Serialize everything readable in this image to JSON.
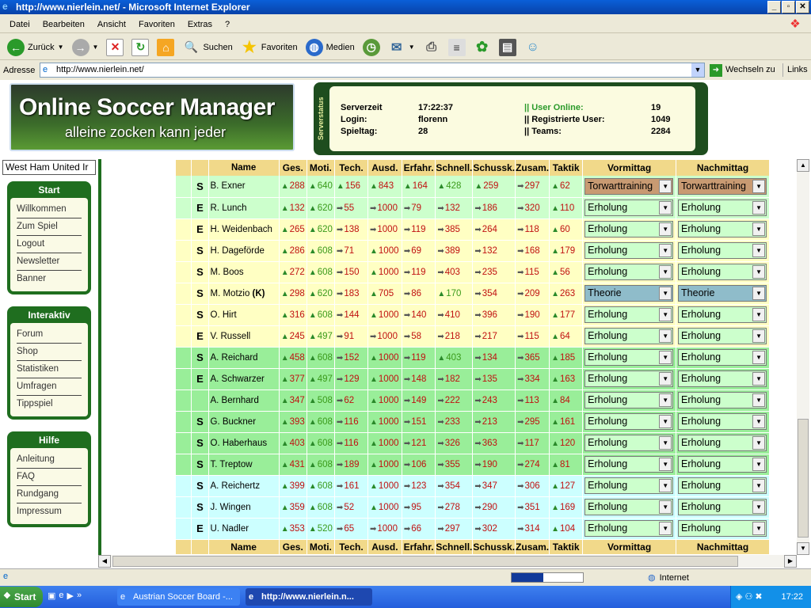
{
  "window": {
    "title": "http://www.nierlein.net/ - Microsoft Internet Explorer"
  },
  "menu": [
    "Datei",
    "Bearbeiten",
    "Ansicht",
    "Favoriten",
    "Extras",
    "?"
  ],
  "toolbar": {
    "back": "Zurück",
    "search": "Suchen",
    "favorites": "Favoriten",
    "media": "Medien"
  },
  "address": {
    "label": "Adresse",
    "url": "http://www.nierlein.net/",
    "go": "Wechseln zu",
    "links": "Links"
  },
  "banner": {
    "title": "Online Soccer Manager",
    "subtitle": "alleine zocken kann jeder"
  },
  "server": {
    "side_label": "Serverstatus",
    "servertime_label": "Serverzeit",
    "servertime": "17:22:37",
    "login_label": "Login:",
    "login": "florenn",
    "matchday_label": "Spieltag:",
    "matchday": "28",
    "online_label": "|| User Online:",
    "online": "19",
    "registered_label": "|| Registrierte User:",
    "registered": "1049",
    "teams_label": "|| Teams:",
    "teams": "2284"
  },
  "sidebar": {
    "team": "West Ham United Ir",
    "boxes": [
      {
        "title": "Start",
        "items": [
          "Willkommen",
          "Zum Spiel",
          "Logout",
          "Newsletter",
          "Banner"
        ]
      },
      {
        "title": "Interaktiv",
        "items": [
          "Forum",
          "Shop",
          "Statistiken",
          "Umfragen",
          "Tippspiel"
        ]
      },
      {
        "title": "Hilfe",
        "items": [
          "Anleitung",
          "FAQ",
          "Rundgang",
          "Impressum"
        ]
      }
    ]
  },
  "table": {
    "headers": [
      "Name",
      "Ges.",
      "Moti.",
      "Tech.",
      "Ausd.",
      "Erfahr.",
      "Schnell.",
      "Schussk.",
      "Zusam.",
      "Taktik",
      "Vormittag",
      "Nachmittag"
    ],
    "rows": [
      {
        "s": "S",
        "name": "B. Exner",
        "vals": [
          "288",
          "640",
          "156",
          "843",
          "164",
          "428",
          "259",
          "297",
          "62"
        ],
        "up": [
          1,
          1,
          1,
          1,
          1,
          1,
          1,
          0,
          1
        ],
        "vm": "Torwarttraining",
        "nm": "Torwarttraining",
        "vmc": "brown",
        "nmc": "brown",
        "bg": "rG"
      },
      {
        "s": "E",
        "name": "R. Lunch",
        "vals": [
          "132",
          "620",
          "55",
          "1000",
          "79",
          "132",
          "186",
          "320",
          "110"
        ],
        "up": [
          1,
          1,
          0,
          0,
          0,
          0,
          0,
          0,
          1
        ],
        "vm": "Erholung",
        "nm": "Erholung",
        "bg": "rG"
      },
      {
        "s": "E",
        "name": "H. Weidenbach",
        "vals": [
          "265",
          "620",
          "138",
          "1000",
          "119",
          "385",
          "264",
          "118",
          "60"
        ],
        "up": [
          1,
          1,
          0,
          0,
          0,
          0,
          0,
          0,
          1
        ],
        "vm": "Erholung",
        "nm": "Erholung",
        "bg": "rY"
      },
      {
        "s": "S",
        "name": "H. Dageförde",
        "vals": [
          "286",
          "608",
          "71",
          "1000",
          "69",
          "389",
          "132",
          "168",
          "179"
        ],
        "up": [
          1,
          1,
          0,
          1,
          0,
          0,
          0,
          0,
          1
        ],
        "vm": "Erholung",
        "nm": "Erholung",
        "bg": "rY"
      },
      {
        "s": "S",
        "name": "M. Boos",
        "vals": [
          "272",
          "608",
          "150",
          "1000",
          "119",
          "403",
          "235",
          "115",
          "56"
        ],
        "up": [
          1,
          1,
          0,
          1,
          0,
          0,
          0,
          0,
          1
        ],
        "vm": "Erholung",
        "nm": "Erholung",
        "bg": "rY"
      },
      {
        "s": "S",
        "name": "M. Motzio",
        "cap": "(K)",
        "vals": [
          "298",
          "620",
          "183",
          "705",
          "86",
          "170",
          "354",
          "209",
          "263"
        ],
        "up": [
          1,
          1,
          0,
          1,
          0,
          1,
          0,
          0,
          1
        ],
        "vm": "Theorie",
        "nm": "Theorie",
        "vmc": "blue",
        "nmc": "blue",
        "bg": "rY"
      },
      {
        "s": "S",
        "name": "O. Hirt",
        "vals": [
          "316",
          "608",
          "144",
          "1000",
          "140",
          "410",
          "396",
          "190",
          "177"
        ],
        "up": [
          1,
          1,
          0,
          1,
          0,
          0,
          0,
          0,
          1
        ],
        "vm": "Erholung",
        "nm": "Erholung",
        "bg": "rY"
      },
      {
        "s": "E",
        "name": "V. Russell",
        "vals": [
          "245",
          "497",
          "91",
          "1000",
          "58",
          "218",
          "217",
          "115",
          "64"
        ],
        "up": [
          1,
          1,
          0,
          0,
          0,
          0,
          0,
          0,
          1
        ],
        "vm": "Erholung",
        "nm": "Erholung",
        "bg": "rY"
      },
      {
        "s": "S",
        "name": "A. Reichard",
        "vals": [
          "458",
          "608",
          "152",
          "1000",
          "119",
          "403",
          "134",
          "365",
          "185"
        ],
        "up": [
          1,
          1,
          0,
          1,
          0,
          1,
          0,
          0,
          1
        ],
        "vm": "Erholung",
        "nm": "Erholung",
        "bg": "rGG"
      },
      {
        "s": "E",
        "name": "A. Schwarzer",
        "vals": [
          "377",
          "497",
          "129",
          "1000",
          "148",
          "182",
          "135",
          "334",
          "163"
        ],
        "up": [
          1,
          1,
          0,
          1,
          0,
          0,
          0,
          0,
          1
        ],
        "vm": "Erholung",
        "nm": "Erholung",
        "bg": "rGG"
      },
      {
        "s": "",
        "name": "A. Bernhard",
        "vals": [
          "347",
          "508",
          "62",
          "1000",
          "149",
          "222",
          "243",
          "113",
          "84"
        ],
        "up": [
          1,
          1,
          0,
          1,
          0,
          0,
          0,
          0,
          1
        ],
        "vm": "Erholung",
        "nm": "Erholung",
        "bg": "rGG"
      },
      {
        "s": "S",
        "name": "G. Buckner",
        "vals": [
          "393",
          "608",
          "116",
          "1000",
          "151",
          "233",
          "213",
          "295",
          "161"
        ],
        "up": [
          1,
          1,
          0,
          1,
          0,
          0,
          0,
          0,
          1
        ],
        "vm": "Erholung",
        "nm": "Erholung",
        "bg": "rGG"
      },
      {
        "s": "S",
        "name": "O. Haberhaus",
        "vals": [
          "403",
          "608",
          "116",
          "1000",
          "121",
          "326",
          "363",
          "117",
          "120"
        ],
        "up": [
          1,
          1,
          0,
          1,
          0,
          0,
          0,
          0,
          1
        ],
        "vm": "Erholung",
        "nm": "Erholung",
        "bg": "rGG"
      },
      {
        "s": "S",
        "name": "T. Treptow",
        "vals": [
          "431",
          "608",
          "189",
          "1000",
          "106",
          "355",
          "190",
          "274",
          "81"
        ],
        "up": [
          1,
          1,
          0,
          1,
          0,
          0,
          0,
          0,
          1
        ],
        "vm": "Erholung",
        "nm": "Erholung",
        "bg": "rGG"
      },
      {
        "s": "S",
        "name": "A. Reichertz",
        "vals": [
          "399",
          "608",
          "161",
          "1000",
          "123",
          "354",
          "347",
          "306",
          "127"
        ],
        "up": [
          1,
          1,
          0,
          1,
          0,
          0,
          0,
          0,
          1
        ],
        "vm": "Erholung",
        "nm": "Erholung",
        "bg": "rB"
      },
      {
        "s": "S",
        "name": "J. Wingen",
        "vals": [
          "359",
          "608",
          "52",
          "1000",
          "95",
          "278",
          "290",
          "351",
          "169"
        ],
        "up": [
          1,
          1,
          0,
          1,
          0,
          0,
          0,
          0,
          1
        ],
        "vm": "Erholung",
        "nm": "Erholung",
        "bg": "rB"
      },
      {
        "s": "E",
        "name": "U. Nadler",
        "vals": [
          "353",
          "520",
          "65",
          "1000",
          "66",
          "297",
          "302",
          "314",
          "104"
        ],
        "up": [
          1,
          1,
          0,
          0,
          0,
          0,
          0,
          0,
          1
        ],
        "vm": "Erholung",
        "nm": "Erholung",
        "bg": "rB"
      }
    ]
  },
  "status": {
    "zone": "Internet"
  },
  "taskbar": {
    "start": "Start",
    "task1": "Austrian Soccer Board -...",
    "task2": "http://www.nierlein.n...",
    "clock": "17:22"
  }
}
